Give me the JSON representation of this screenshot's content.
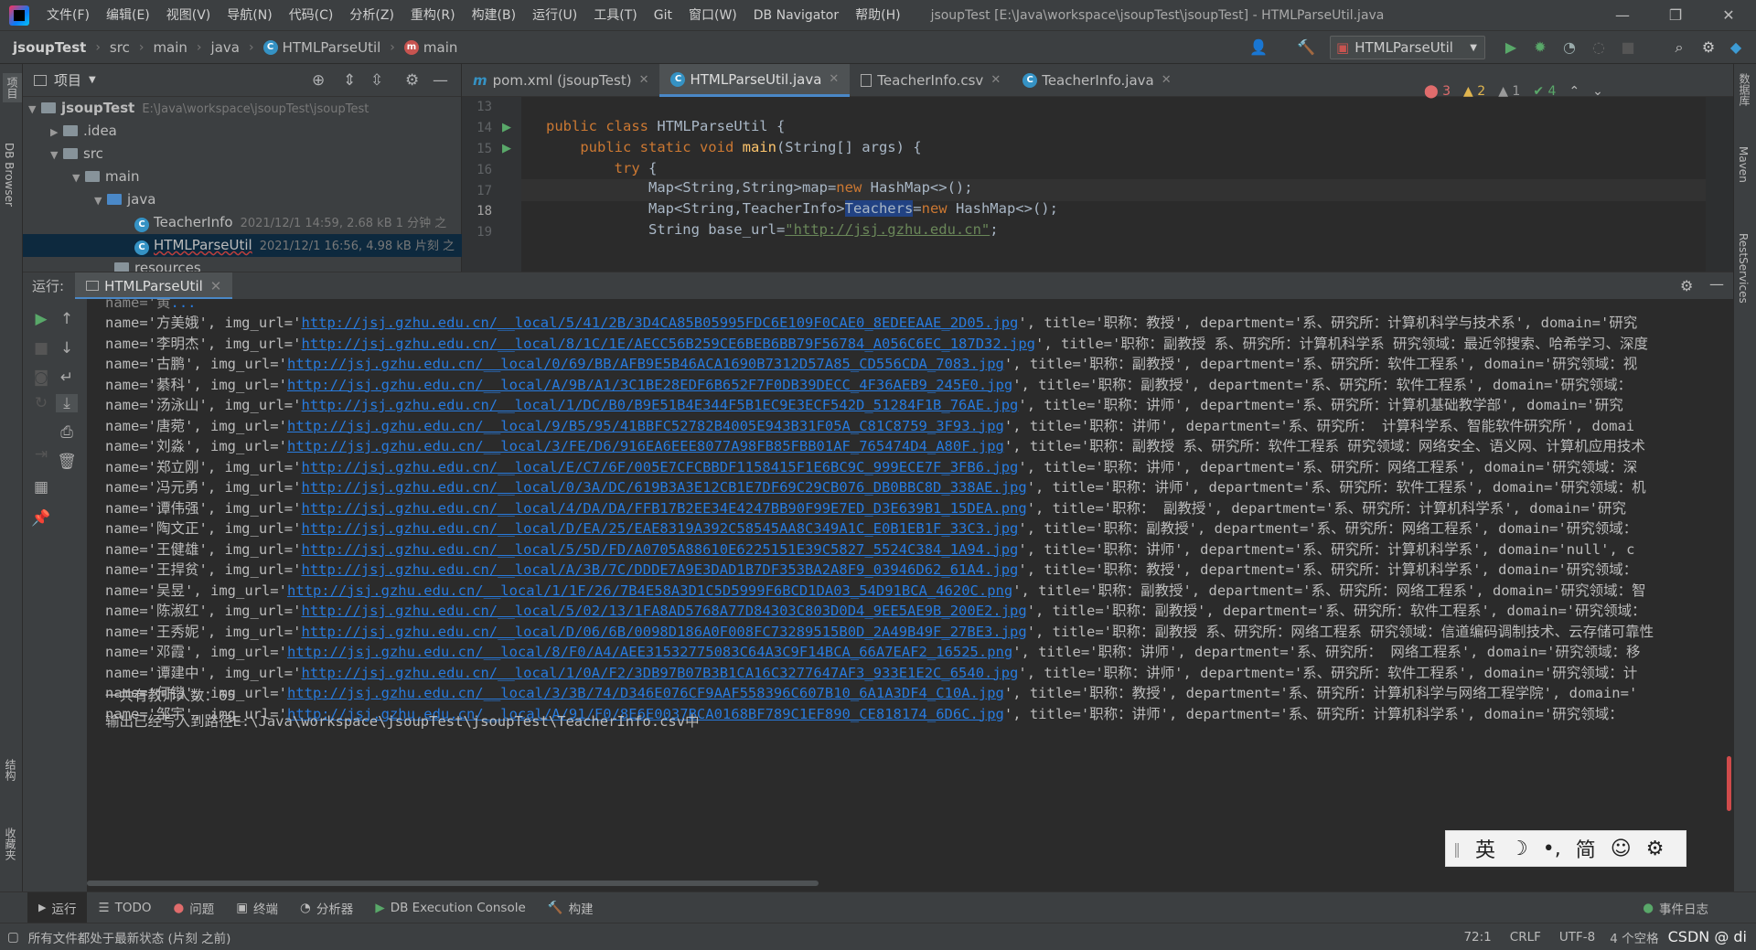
{
  "menu": {
    "items": [
      "文件(F)",
      "编辑(E)",
      "视图(V)",
      "导航(N)",
      "代码(C)",
      "分析(Z)",
      "重构(R)",
      "构建(B)",
      "运行(U)",
      "工具(T)",
      "Git",
      "窗口(W)",
      "DB Navigator",
      "帮助(H)"
    ],
    "window_title": "jsoupTest [E:\\Java\\workspace\\jsoupTest\\jsoupTest] - HTMLParseUtil.java"
  },
  "breadcrumb": [
    "jsoupTest",
    "src",
    "main",
    "java",
    "HTMLParseUtil",
    "main"
  ],
  "run_config": "HTMLParseUtil",
  "left_strip": {
    "project": "项目",
    "db_browser": "DB Browser",
    "structure": "结构",
    "favorites": "收藏夹"
  },
  "right_strip": {
    "database": "数据库",
    "maven": "Maven",
    "rest": "RestServices"
  },
  "project_panel": {
    "title": "项目",
    "root_name": "jsoupTest",
    "root_path": "E:\\Java\\workspace\\jsoupTest\\jsoupTest",
    "idea": ".idea",
    "src": "src",
    "main": "main",
    "java": "java",
    "file1_name": "TeacherInfo",
    "file1_meta": "2021/12/1 14:59, 2.68 kB 1 分钟 之",
    "file2_name": "HTMLParseUtil",
    "file2_meta": "2021/12/1 16:56, 4.98 kB 片刻 之",
    "resources": "resources"
  },
  "editor": {
    "tabs": [
      {
        "label": "pom.xml (jsoupTest)"
      },
      {
        "label": "HTMLParseUtil.java"
      },
      {
        "label": "TeacherInfo.csv"
      },
      {
        "label": "TeacherInfo.java"
      }
    ],
    "line_numbers": [
      "13",
      "14",
      "15",
      "16",
      "17",
      "18",
      "19"
    ],
    "code": {
      "l14_a": "public class ",
      "l14_b": "HTMLParseUtil {",
      "l15_a": "    public static void ",
      "l15_b": "main",
      "l15_c": "(String[] args) {",
      "l16_a": "        try",
      "l16_b": " {",
      "l17_a": "            Map<String,String>map=",
      "l17_b": "new",
      "l17_c": " HashMap<>();",
      "l18_a": "            Map<String,TeacherInfo>",
      "l18_b": "Teachers",
      "l18_c": "=",
      "l18_d": "new",
      "l18_e": " HashMap<>();",
      "l19_a": "            String base_url=",
      "l19_b": "\"http://jsj.gzhu.edu.cn\"",
      "l19_c": ";"
    },
    "inspections": {
      "errors": "3",
      "warnings": "2",
      "weak_warnings": "1",
      "ok": "4"
    }
  },
  "run_panel": {
    "label": "运行:",
    "tab": "HTMLParseUtil",
    "lines": [
      {
        "pre": "name='方美娥', img_url='",
        "url": "http://jsj.gzhu.edu.cn/__local/5/41/2B/3D4CA85B05995FDC6E109F0CAE0_8EDEEAAE_2D05.jpg",
        "post": "', title='职称：教授', department='系、研究所：计算机科学与技术系', domain='研究"
      },
      {
        "pre": "name='李明杰', img_url='",
        "url": "http://jsj.gzhu.edu.cn/__local/8/1C/1E/AECC56B259CE6BEB6BB79F56784_A056C6EC_187D32.jpg",
        "post": "', title='职称：副教授 系、研究所：计算机科学系 研究领域：最近邻搜索、哈希学习、深度"
      },
      {
        "pre": "name='古鹏', img_url='",
        "url": "http://jsj.gzhu.edu.cn/__local/0/69/BB/AFB9E5B46ACA1690B7312D57A85_CD556CDA_7083.jpg",
        "post": "', title='职称：副教授', department='系、研究所：软件工程系', domain='研究领域：视"
      },
      {
        "pre": "name='綦科', img_url='",
        "url": "http://jsj.gzhu.edu.cn/__local/A/9B/A1/3C1BE28EDF6B652F7F0DB39DECC_4F36AEB9_245E0.jpg",
        "post": "', title='职称：副教授', department='系、研究所：软件工程系', domain='研究领域："
      },
      {
        "pre": "name='汤泳山', img_url='",
        "url": "http://jsj.gzhu.edu.cn/__local/1/DC/B0/B9E51B4E344F5B1EC9E3ECF542D_51284F1B_76AE.jpg",
        "post": "', title='职称：讲师', department='系、研究所：计算机基础教学部', domain='研究"
      },
      {
        "pre": "name='唐菀', img_url='",
        "url": "http://jsj.gzhu.edu.cn/__local/9/B5/95/41BBFC52782B4005E943B31F05A_C81C8759_3F93.jpg",
        "post": "', title='职称：讲师', department='系、研究所： 计算科学系、智能软件研究所', domai"
      },
      {
        "pre": "name='刘淼', img_url='",
        "url": "http://jsj.gzhu.edu.cn/__local/3/FE/D6/916EA6EEE8077A98FB85FBB01AF_765474D4_A80F.jpg",
        "post": "', title='职称：副教授 系、研究所：软件工程系 研究领域：网络安全、语义网、计算机应用技术"
      },
      {
        "pre": "name='郑立刚', img_url='",
        "url": "http://jsj.gzhu.edu.cn/__local/E/C7/6F/005E7CFCBBDF1158415F1E6BC9C_999ECE7F_3FB6.jpg",
        "post": "', title='职称：讲师', department='系、研究所：网络工程系', domain='研究领域：深"
      },
      {
        "pre": "name='冯元勇', img_url='",
        "url": "http://jsj.gzhu.edu.cn/__local/0/3A/DC/619B3A3E12CB1E7DF69C29CB076_DB0BBC8D_338AE.jpg",
        "post": "', title='职称：讲师', department='系、研究所：软件工程系', domain='研究领域：机"
      },
      {
        "pre": "name='谭伟强', img_url='",
        "url": "http://jsj.gzhu.edu.cn/__local/4/DA/DA/FFB17B2EE34E4247BB90F99E7ED_D3E639B1_15DEA.png",
        "post": "', title='职称： 副教授', department='系、研究所：计算机科学系', domain='研究"
      },
      {
        "pre": "name='陶文正', img_url='",
        "url": "http://jsj.gzhu.edu.cn/__local/D/EA/25/EAE8319A392C58545AA8C349A1C_E0B1EB1F_33C3.jpg",
        "post": "', title='职称：副教授', department='系、研究所：网络工程系', domain='研究领域："
      },
      {
        "pre": "name='王健雄', img_url='",
        "url": "http://jsj.gzhu.edu.cn/__local/5/5D/FD/A0705A88610E6225151E39C5827_5524C384_1A94.jpg",
        "post": "', title='职称：讲师', department='系、研究所：计算机科学系', domain='null', c"
      },
      {
        "pre": "name='王捍贫', img_url='",
        "url": "http://jsj.gzhu.edu.cn/__local/A/3B/7C/DDDE7A9E3DAD1B7DF353BA2A8F9_03946D62_61A4.jpg",
        "post": "', title='职称：教授', department='系、研究所：计算机科学系', domain='研究领域："
      },
      {
        "pre": "name='吴昱', img_url='",
        "url": "http://jsj.gzhu.edu.cn/__local/1/1F/26/7B4E58A3D1C5D5999F6BCD1DA03_54D91BCA_4620C.png",
        "post": "', title='职称：副教授', department='系、研究所：网络工程系', domain='研究领域：智"
      },
      {
        "pre": "name='陈淑红', img_url='",
        "url": "http://jsj.gzhu.edu.cn/__local/5/02/13/1FA8AD5768A77D84303C803D0D4_9EE5AE9B_200E2.jpg",
        "post": "', title='职称：副教授', department='系、研究所：软件工程系', domain='研究领域："
      },
      {
        "pre": "name='王秀妮', img_url='",
        "url": "http://jsj.gzhu.edu.cn/__local/D/06/6B/0098D186A0F008FC73289515B0D_2A49B49F_27BE3.jpg",
        "post": "', title='职称：副教授 系、研究所：网络工程系 研究领域：信道编码调制技术、云存储可靠性"
      },
      {
        "pre": "name='邓霞', img_url='",
        "url": "http://jsj.gzhu.edu.cn/__local/8/F0/A4/AEE31532775083C64A3C9F14BCA_66A7EAF2_16525.png",
        "post": "', title='职称：讲师', department='系、研究所： 网络工程系', domain='研究领域：移"
      },
      {
        "pre": "name='谭建中', img_url='",
        "url": "http://jsj.gzhu.edu.cn/__local/1/0A/F2/3DB97B07B3B1CA16C3277647AF3_933E1E2C_6540.jpg",
        "post": "', title='职称：讲师', department='系、研究所：软件工程系', domain='研究领域：计"
      },
      {
        "pre": "name='何锴', img_url='",
        "url": "http://jsj.gzhu.edu.cn/__local/3/3B/74/D346E076CF9AAF558396C607B10_6A1A3DF4_C10A.jpg",
        "post": "', title='职称：教授', department='系、研究所：计算机科学与网络工程学院', domain='"
      },
      {
        "pre": "name='邹宇', img_url='",
        "url": "http://jsj.gzhu.edu.cn/__local/A/91/F0/8E6E0037BCA0168BF789C1EF890_CE818174_6D6C.jpg",
        "post": "', title='职称：讲师', department='系、研究所：计算机科学系', domain='研究领域："
      }
    ],
    "summary": "一共有教师人数：65",
    "output_msg": "输出已经写入到路径E:\\Java\\workspace\\jsoupTest\\jsoupTest\\TeacherInfo.csv中"
  },
  "ime": {
    "lang": "英",
    "moon": "☽",
    "punct": "•,",
    "simp": "简",
    "emoji": "☺",
    "gear": "⚙"
  },
  "bottom_tools": [
    "运行",
    "TODO",
    "问题",
    "终端",
    "分析器",
    "DB Execution Console",
    "构建"
  ],
  "event_log": "事件日志",
  "status": {
    "message": "所有文件都处于最新状态 (片刻 之前)",
    "position": "72:1",
    "line_sep": "CRLF",
    "encoding": "UTF-8",
    "indent": "4 个空格",
    "watermark": "CSDN @ di"
  }
}
